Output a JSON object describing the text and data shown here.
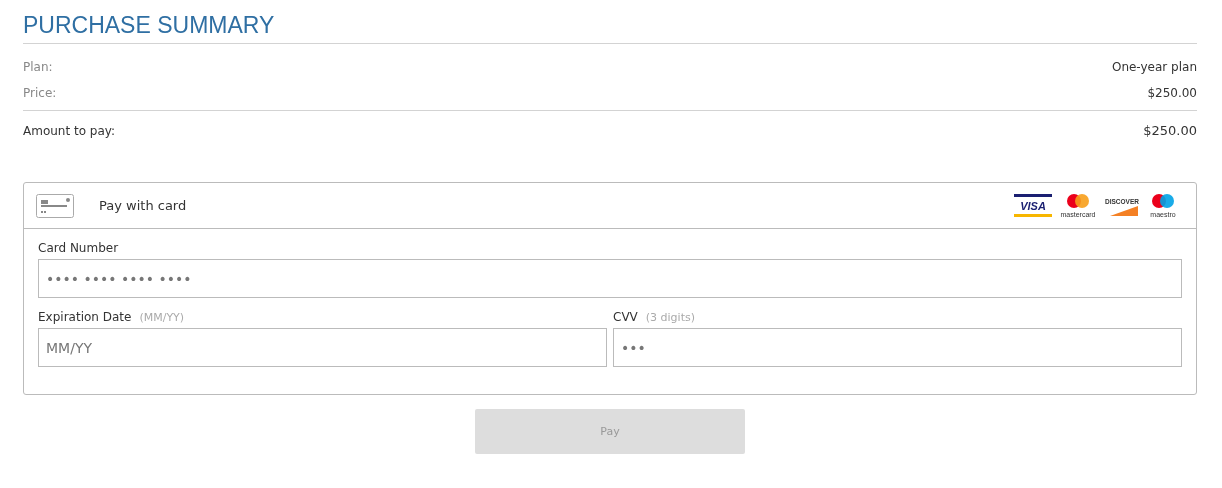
{
  "title": "PURCHASE SUMMARY",
  "summary_rows": [
    {
      "label": "Plan:",
      "value": "One-year plan"
    },
    {
      "label": "Price:",
      "value": "$250.00"
    }
  ],
  "total": {
    "label": "Amount to pay:",
    "value": "$250.00"
  },
  "payment": {
    "heading": "Pay with card",
    "brands": [
      {
        "kind": "visa",
        "label": "VISA"
      },
      {
        "kind": "mastercard",
        "label": "mastercard"
      },
      {
        "kind": "discover",
        "label": "DISCOVER"
      },
      {
        "kind": "maestro",
        "label": "maestro"
      }
    ],
    "card_number": {
      "label": "Card Number",
      "placeholder": "•••• •••• •••• ••••"
    },
    "expiration": {
      "label": "Expiration Date",
      "hint": "(MM/YY)",
      "placeholder": "MM/YY"
    },
    "cvv": {
      "label": "CVV",
      "hint": "(3 digits)",
      "placeholder": "•••"
    }
  },
  "pay_button": {
    "label": "Pay",
    "disabled": true
  }
}
